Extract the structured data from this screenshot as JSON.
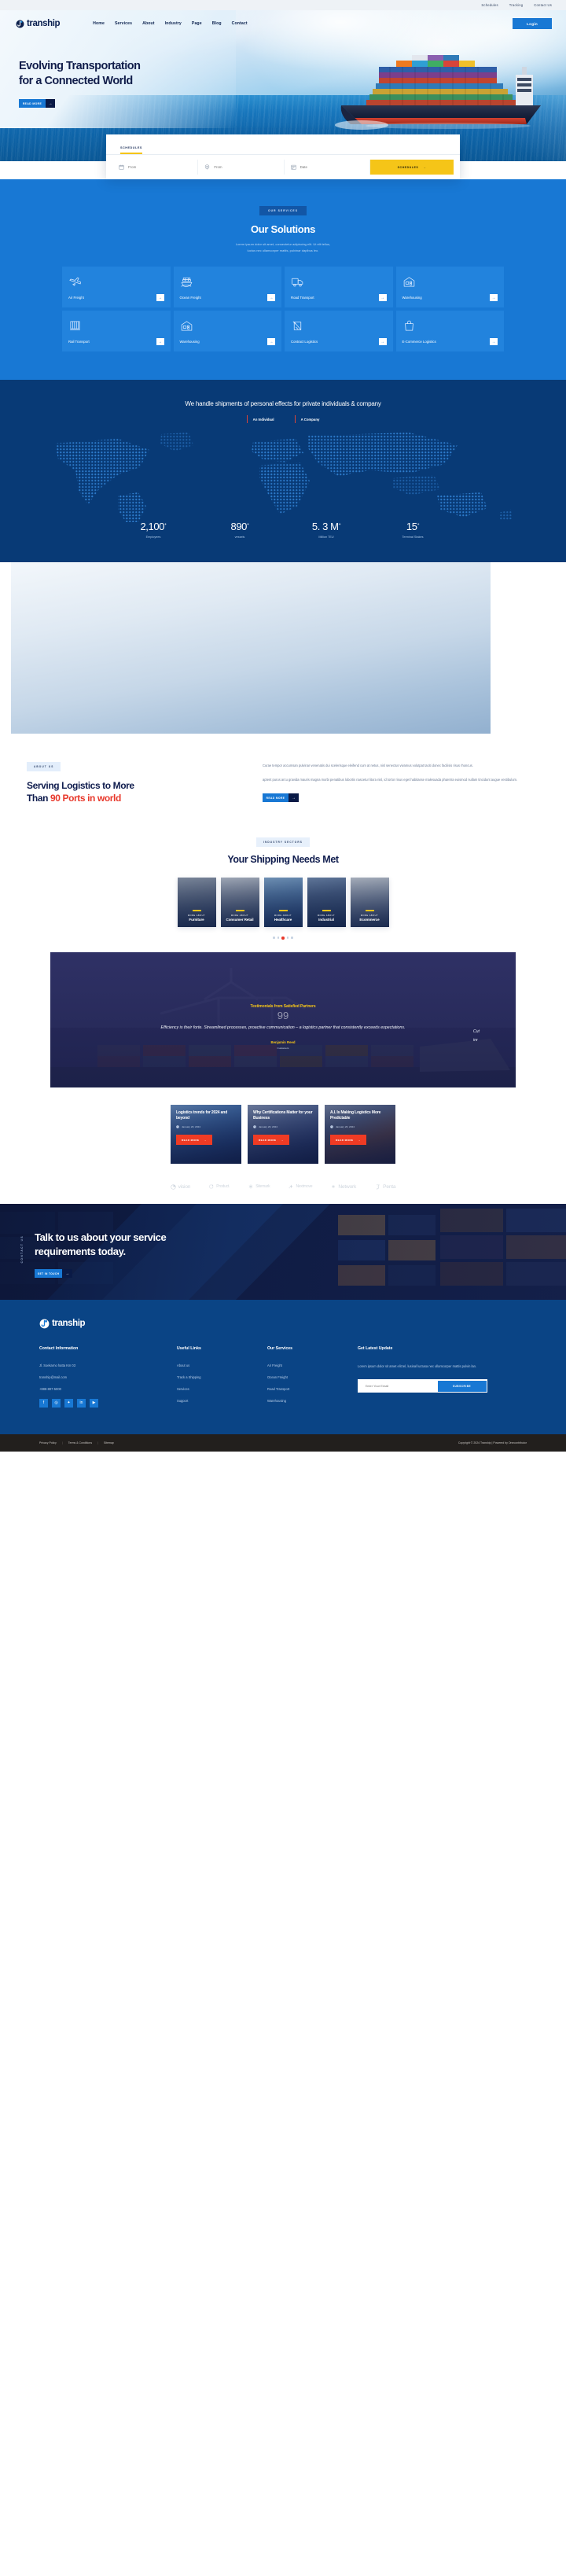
{
  "topbar": {
    "links": [
      "Schedules",
      "Tracking",
      "Contact Us"
    ]
  },
  "header": {
    "brand": "transhlp",
    "brand_name": "tranship",
    "nav": [
      "Home",
      "Services",
      "About",
      "Industry",
      "Page",
      "Blog",
      "Contact"
    ],
    "login_label": "Login"
  },
  "hero": {
    "title_line1": "Evolving Transportation",
    "title_line2": "for a Connected World",
    "button_label": "READ MORE"
  },
  "schedules": {
    "tab_label": "SCHEDULES",
    "field_from_placeholder": "From",
    "field_to_placeholder": "From",
    "field_date_placeholder": "Date",
    "submit_label": "SCHEDULES",
    "icons": [
      "calendar-icon",
      "location-pin-icon",
      "date-grid-icon"
    ]
  },
  "solutions": {
    "pill": "OUR SERVICES",
    "title": "Our Solutions",
    "subtitle_line1": "Lorem ipsum dolor sit amet, consectetur adipiscing elit. Ut elit tellus,",
    "subtitle_line2": "luctus nec ullamcorper mattis, pulvinar dapibus leo.",
    "cards": [
      {
        "label": "Air Freight",
        "icon": "airplane-icon"
      },
      {
        "label": "Ocean Freight",
        "icon": "container-ship-icon"
      },
      {
        "label": "Road Transport",
        "icon": "truck-icon"
      },
      {
        "label": "Warehousing",
        "icon": "warehouse-icon"
      },
      {
        "label": "Rail Transport",
        "icon": "train-icon"
      },
      {
        "label": "Warehousing",
        "icon": "warehouse-icon"
      },
      {
        "label": "Contract Logistics",
        "icon": "package-contract-icon"
      },
      {
        "label": "E-Commerce Logistics",
        "icon": "shopping-bag-icon"
      }
    ]
  },
  "stats_section": {
    "headline": "We handle shipments of personal effects for private individuals & company",
    "segments": [
      "An Individual",
      "A Company"
    ],
    "stats": [
      {
        "value": "2,100",
        "sup": "+",
        "label": "Employees"
      },
      {
        "value": "890",
        "sup": "+",
        "label": "vessels"
      },
      {
        "value": "5. 3 M",
        "sup": "+",
        "label": "Million TEU"
      },
      {
        "value": "15",
        "sup": "+",
        "label": "Terminal Stakes"
      }
    ]
  },
  "about": {
    "pill": "ABOUT US",
    "title_line1": "Serving Logistics to More",
    "title_line2_plain": "Than ",
    "title_line2_accent": "90 Ports in world",
    "paragraph1": "Curae tempor accumsan pulvinar venenatis dui scelerisque eleifend cum at netus, nisl senectus vivamus volutpat taciti donec facilisis risus rhoncus.",
    "paragraph2": "aptent purus arcu gravida mauris magna morbi penatibus lobortis nascetur litora nisl, id tortor risus eget habitasse malesuada pharetra euismod nullam tincidunt augue vestibulum.",
    "button_label": "READ MORE"
  },
  "industry": {
    "pill": "INDUSTRY SECTORS",
    "title": "Your Shipping Needs Met",
    "cards": [
      {
        "kicker": "MORE ABOUT",
        "name": "Furniture"
      },
      {
        "kicker": "MORE ABOUT",
        "name": "Consumer Retail"
      },
      {
        "kicker": "MORE ABOUT",
        "name": "Healthcare"
      },
      {
        "kicker": "MORE ABOUT",
        "name": "Industrial"
      },
      {
        "kicker": "MORE ABOUT",
        "name": "Ecommerce"
      }
    ],
    "active_dot": 2,
    "dot_count": 5
  },
  "testimonial": {
    "kicker": "Testimonials from Satisfied Partners",
    "quote_mark": "99",
    "quote": "Efficiency is their forte. Streamlined processes, proactive communication – a logistics partner that consistently exceeds expectations.",
    "side_line1": "Cut",
    "side_line2": "inr",
    "author": "Benjamin Reed",
    "role": "Customers"
  },
  "blog": {
    "posts": [
      {
        "title": "Logistics trends for 2024 and beyond",
        "date": "January 20, 2024",
        "button": "READ MORE"
      },
      {
        "title": "Why Certifications Matter for your Business",
        "date": "January 20, 2024",
        "button": "READ MORE"
      },
      {
        "title": "A.I. Is Making Logistics More Predictable",
        "date": "January 20, 2024",
        "button": "READ MORE"
      }
    ]
  },
  "partners": [
    {
      "name": "vision",
      "icon": "pie-icon"
    },
    {
      "name": "Product.",
      "icon": "rounded-square-icon"
    },
    {
      "name": "Sitemark",
      "icon": "asterisk-icon"
    },
    {
      "name": "Nextmove",
      "icon": "sparkle-icon"
    },
    {
      "name": "Network",
      "icon": "star-burst-icon"
    },
    {
      "name": "Penta",
      "icon": "swoosh-icon"
    }
  ],
  "cta": {
    "vertical_label": "CONTACT US",
    "title_line1": "Talk to us about your service",
    "title_line2": "requirements today.",
    "button_label": "GET IN TOUCH"
  },
  "footer": {
    "brand_name": "tranship",
    "contact": {
      "heading": "Contact Information",
      "address": "Jl. Soekarno hatta Km 03",
      "email": "tranship@mail.com",
      "phone": "+888-807-5000",
      "socials": [
        "facebook-icon",
        "instagram-icon",
        "twitter-icon",
        "linkedin-icon",
        "youtube-icon"
      ]
    },
    "useful_links": {
      "heading": "Useful Links",
      "items": [
        "About us",
        "Track a Shipping",
        "Services",
        "Support"
      ]
    },
    "our_services": {
      "heading": "Our Services",
      "items": [
        "Air Freight",
        "Ocean Freight",
        "Road Transport",
        "Warehousing"
      ]
    },
    "newsletter": {
      "heading": "Get Latest Update",
      "text": "Lorem ipsum dolor sit amet elit tel, lusinal luctusa nec ullamcorper mattis pulvin lan.",
      "placeholder": "Enter Your Email",
      "button": "SUBSCRIBE"
    },
    "bottom": {
      "links": [
        "Privacy Policy",
        "Terms & Conditions",
        "Sitemap"
      ],
      "separator": "|",
      "copyright": "Copyright © 2024 Tranship | Powered by Onecontributor"
    }
  }
}
